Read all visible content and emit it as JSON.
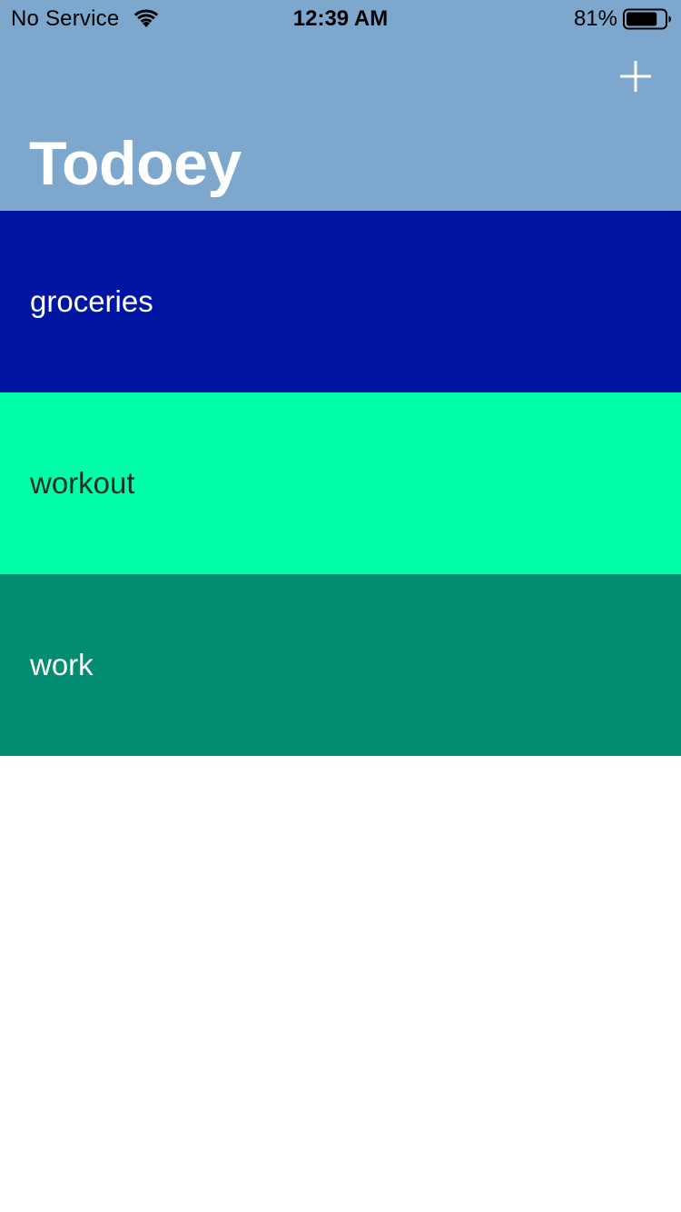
{
  "status_bar": {
    "carrier": "No Service",
    "time": "12:39 AM",
    "battery_percent": "81%",
    "battery_level": 0.81,
    "wifi_icon": "wifi-icon",
    "battery_icon": "battery-icon"
  },
  "nav": {
    "title": "Todoey",
    "add_icon": "plus-icon",
    "background_color": "#7EA7CD",
    "title_color": "#FFFFFF"
  },
  "categories": [
    {
      "name": "groceries",
      "background_color": "#0016A3",
      "text_color": "#FFFFFF"
    },
    {
      "name": "workout",
      "background_color": "#00FFAA",
      "text_color": "#1A2E24"
    },
    {
      "name": "work",
      "background_color": "#028C71",
      "text_color": "#FFFFFF"
    }
  ]
}
